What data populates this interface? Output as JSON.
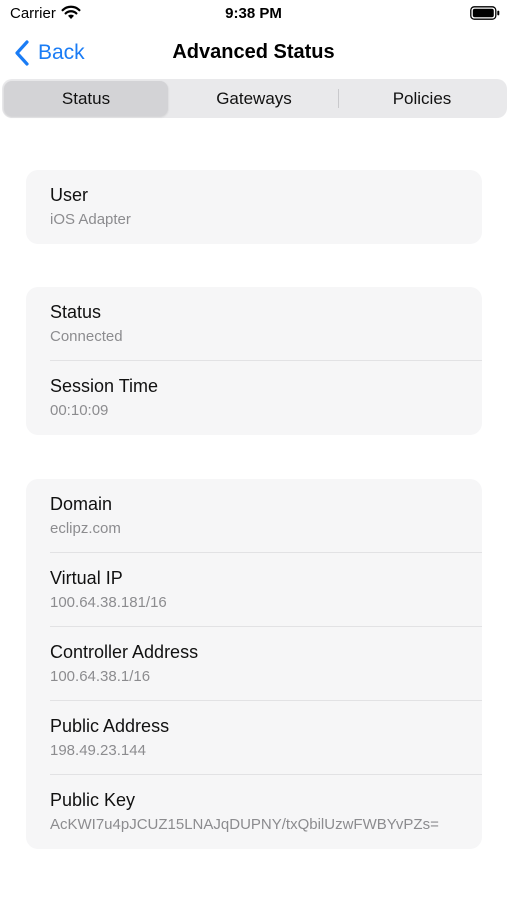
{
  "status_bar": {
    "carrier": "Carrier",
    "time": "9:38 PM",
    "icons": [
      "wifi-icon",
      "battery-icon"
    ]
  },
  "nav": {
    "back_label": "Back",
    "title": "Advanced Status",
    "back_icon": "chevron-left-icon",
    "accent_color": "#1a7cf5"
  },
  "tabs": [
    {
      "label": "Status",
      "selected": true
    },
    {
      "label": "Gateways",
      "selected": false
    },
    {
      "label": "Policies",
      "selected": false
    }
  ],
  "sections": {
    "user": {
      "user": {
        "label": "User",
        "value": "iOS Adapter"
      }
    },
    "session": {
      "status": {
        "label": "Status",
        "value": "Connected"
      },
      "session_time": {
        "label": "Session Time",
        "value": "00:10:09"
      }
    },
    "network": {
      "domain": {
        "label": "Domain",
        "value": "eclipz.com"
      },
      "virtual_ip": {
        "label": "Virtual IP",
        "value": "100.64.38.181/16"
      },
      "controller_address": {
        "label": "Controller Address",
        "value": "100.64.38.1/16"
      },
      "public_address": {
        "label": "Public Address",
        "value": "198.49.23.144"
      },
      "public_key": {
        "label": "Public Key",
        "value": "AcKWI7u4pJCUZ15LNAJqDUPNY/txQbilUzwFWBYvPZs="
      }
    }
  }
}
